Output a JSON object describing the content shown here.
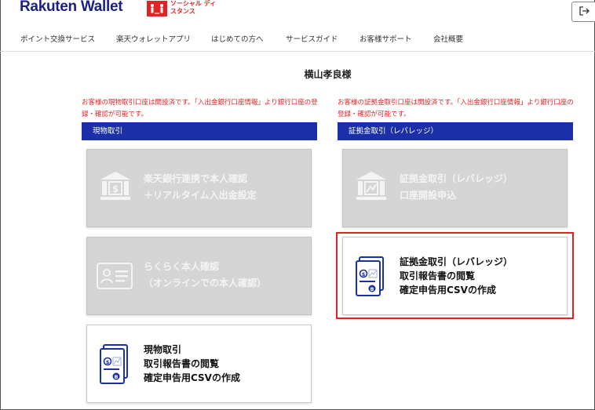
{
  "header": {
    "logo": "Rakuten Wallet",
    "badge_text": "ソーシャル ディスタンス",
    "logout_icon": "logout-icon"
  },
  "nav": {
    "items": [
      "ポイント交換サービス",
      "楽天ウォレットアプリ",
      "はじめての方へ",
      "サービスガイド",
      "お客様サポート",
      "会社概要"
    ]
  },
  "user": {
    "name": "横山孝良様"
  },
  "spot": {
    "notice": "お客様の現物取引口座は開設済です。「入出金銀行口座情報」より銀行口座の登録・確認が可能です。",
    "section_title": "現物取引",
    "cards": [
      {
        "line1": "楽天銀行連携で本人確認",
        "line2": "＋リアルタイム入出金設定",
        "icon": "bank-icon"
      },
      {
        "line1": "らくらく本人確認",
        "line2": "（オンラインでの本人確認）",
        "icon": "id-card-icon"
      },
      {
        "line1": "現物取引",
        "line2": "取引報告書の閲覧",
        "line3": "確定申告用CSVの作成",
        "icon": "document-icon"
      }
    ]
  },
  "margin": {
    "notice": "お客様の証拠金取引口座は開設済です。「入出金銀行口座情報」より銀行口座の登録・確認が可能です。",
    "section_title": "証拠金取引（レバレッジ）",
    "cards": [
      {
        "line1": "証拠金取引（レバレッジ）",
        "line2": "口座開設申込",
        "icon": "bank-icon"
      },
      {
        "line1": "証拠金取引（レバレッジ）",
        "line2": "取引報告書の閲覧",
        "line3": "確定申告用CSVの作成",
        "icon": "document-icon"
      }
    ]
  },
  "colors": {
    "brand": "#1a237e",
    "section_bar": "#1b2fa8",
    "notice": "#e02424",
    "disabled_card": "#d5d5d5",
    "icon_blue": "#1b2fa8"
  }
}
